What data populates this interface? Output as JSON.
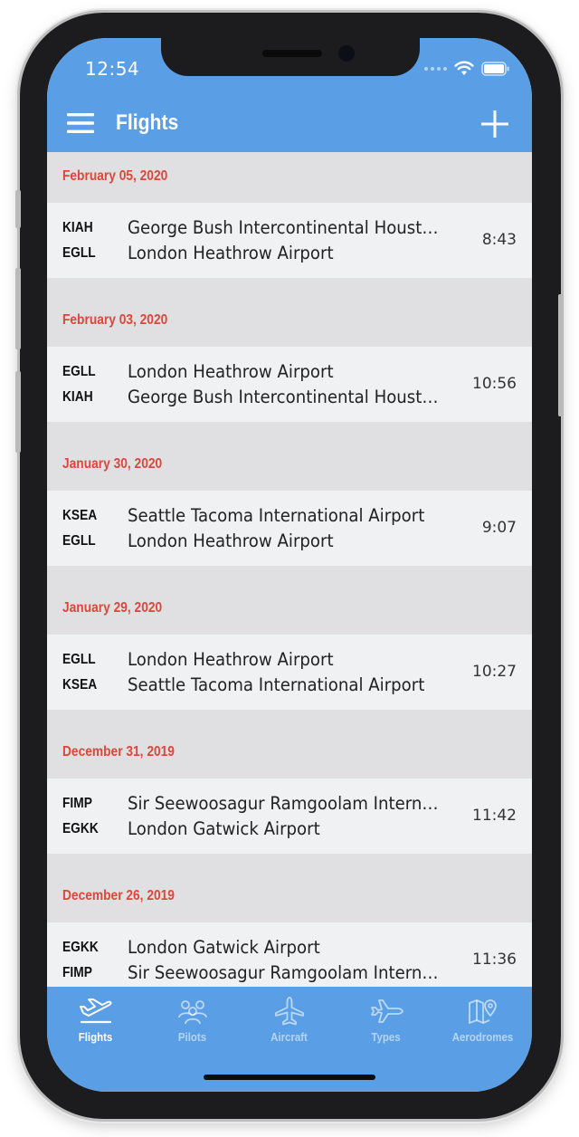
{
  "status_bar": {
    "time": "12:54"
  },
  "header": {
    "title": "Flights",
    "menu_icon": "hamburger-menu-icon",
    "add_icon": "plus-icon"
  },
  "sections": [
    {
      "date": "February 05, 2020",
      "flight": {
        "from_code": "KIAH",
        "from_name": "George Bush Intercontinental Houston...",
        "to_code": "EGLL",
        "to_name": "London Heathrow Airport",
        "duration": "8:43"
      }
    },
    {
      "date": "February 03, 2020",
      "flight": {
        "from_code": "EGLL",
        "from_name": "London Heathrow Airport",
        "to_code": "KIAH",
        "to_name": "George Bush Intercontinental Houston...",
        "duration": "10:56"
      }
    },
    {
      "date": "January 30, 2020",
      "flight": {
        "from_code": "KSEA",
        "from_name": "Seattle Tacoma International Airport",
        "to_code": "EGLL",
        "to_name": "London Heathrow Airport",
        "duration": "9:07"
      }
    },
    {
      "date": "January 29, 2020",
      "flight": {
        "from_code": "EGLL",
        "from_name": "London Heathrow Airport",
        "to_code": "KSEA",
        "to_name": "Seattle Tacoma International Airport",
        "duration": "10:27"
      }
    },
    {
      "date": "December 31, 2019",
      "flight": {
        "from_code": "FIMP",
        "from_name": "Sir Seewoosagur Ramgoolam Internatio...",
        "to_code": "EGKK",
        "to_name": "London Gatwick Airport",
        "duration": "11:42"
      }
    },
    {
      "date": "December 26, 2019",
      "flight": {
        "from_code": "EGKK",
        "from_name": "London Gatwick Airport",
        "to_code": "FIMP",
        "to_name": "Sir Seewoosagur Ramgoolam Internatio...",
        "duration": "11:36"
      }
    }
  ],
  "tabs": [
    {
      "label": "Flights",
      "icon": "airplane-takeoff-icon",
      "active": true
    },
    {
      "label": "Pilots",
      "icon": "people-group-icon",
      "active": false
    },
    {
      "label": "Aircraft",
      "icon": "airplane-icon",
      "active": false
    },
    {
      "label": "Types",
      "icon": "fighter-jet-icon",
      "active": false
    },
    {
      "label": "Aerodromes",
      "icon": "map-pin-icon",
      "active": false
    }
  ],
  "colors": {
    "primary": "#5a9fe6",
    "date_header": "#e0453a",
    "row_background": "#f0f1f3",
    "section_background": "#e0e0e2"
  }
}
